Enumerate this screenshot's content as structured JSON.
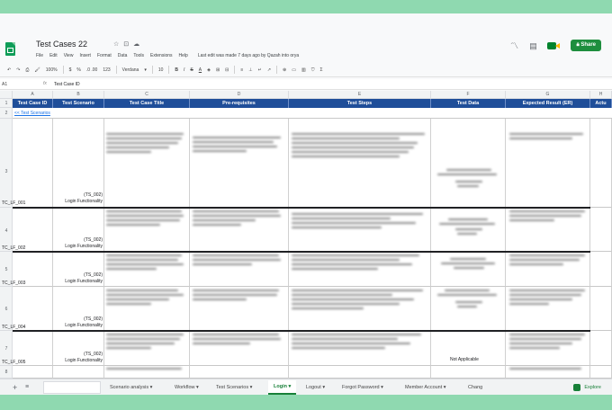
{
  "app": {
    "title": "Test Cases 22",
    "menus": [
      "File",
      "Edit",
      "View",
      "Insert",
      "Format",
      "Data",
      "Tools",
      "Extensions",
      "Help"
    ],
    "notice": "Last edit was made 7 days ago by Qazah into orya",
    "share_label": "Share"
  },
  "toolbar": {
    "zoom": "100%",
    "currency": "$",
    "percent": "%",
    "decimals": ".0  .00",
    "number_format": "123",
    "font": "Verdana",
    "font_size": "10",
    "bold": "B",
    "italic": "I",
    "strike": "S",
    "text_color": "A"
  },
  "formula": {
    "cell_ref": "A1",
    "fx": "fx",
    "value": "Test Case ID"
  },
  "columns": [
    "A",
    "B",
    "C",
    "D",
    "E",
    "F",
    "G",
    "H"
  ],
  "headers": [
    "Test Case ID",
    "Test Scenario",
    "Test Case Title",
    "Pre-requisites",
    "Test Steps",
    "Test Data",
    "Expected Result (ER)",
    "Actu"
  ],
  "link_text": "<< Test Scenarios",
  "row_numbers": [
    "1",
    "2",
    "3",
    "4",
    "5",
    "6",
    "7",
    "8"
  ],
  "rows": [
    {
      "id": "TC_LF_001",
      "sc_code": "(TS_002)",
      "sc_name": "Login Functionality"
    },
    {
      "id": "TC_LF_002",
      "sc_code": "(TS_002)",
      "sc_name": "Login Functionality"
    },
    {
      "id": "TC_LF_003",
      "sc_code": "(TS_002)",
      "sc_name": "Login Functionality"
    },
    {
      "id": "TC_LF_004",
      "sc_code": "(TS_002)",
      "sc_name": "Login Functionality"
    },
    {
      "id": "TC_LF_005",
      "sc_code": "(TS_002)",
      "sc_name": "Login Functionality"
    }
  ],
  "extra_text": {
    "not_applicable": "Not Applicable"
  },
  "tabs": {
    "items": [
      "Scenario analysis",
      "Workflow",
      "Test Scenarios",
      "Login",
      "Logout",
      "Forgot Password",
      "Member Account",
      "Chang"
    ],
    "active": "Login",
    "explore": "Explore"
  },
  "colors": {
    "header_bg": "#1f4e99",
    "share_bg": "#1e8e3e",
    "band": "#8fd9b0"
  }
}
